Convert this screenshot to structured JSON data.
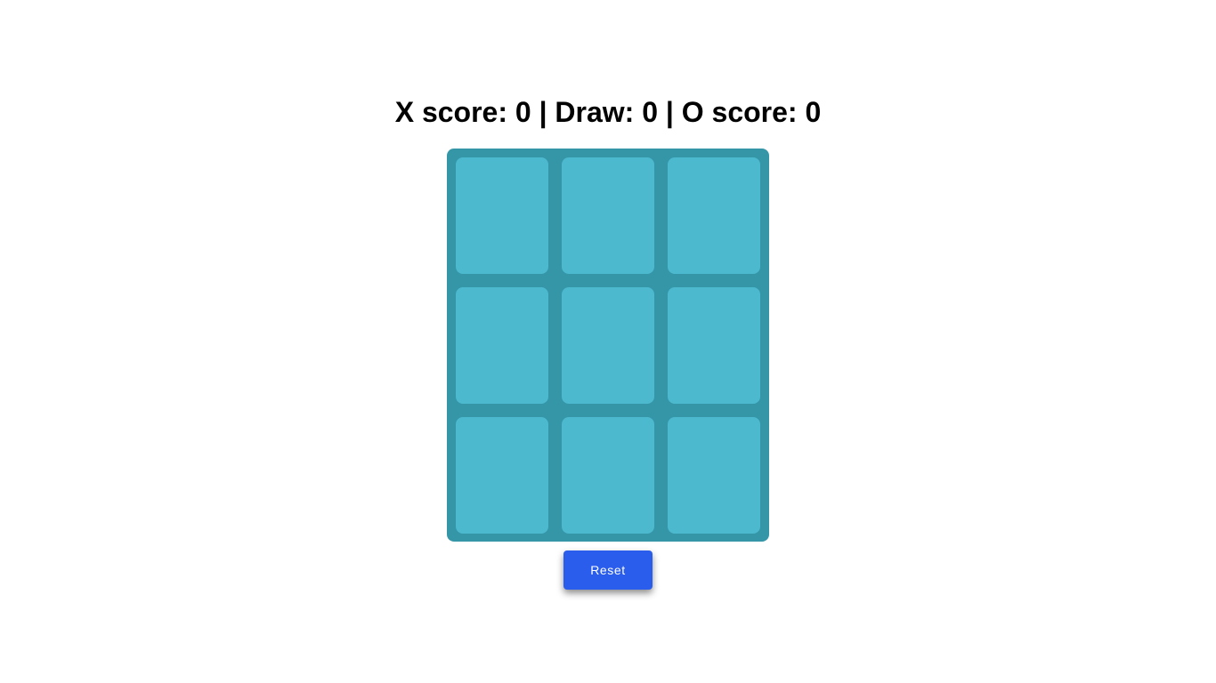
{
  "scoreboard": {
    "x_label": "X score: ",
    "x_score": "0",
    "sep1": " | ",
    "draw_label": "Draw: ",
    "draw_score": "0",
    "sep2": " | ",
    "o_label": "O score: ",
    "o_score": "0"
  },
  "board": {
    "cells": [
      "",
      "",
      "",
      "",
      "",
      "",
      "",
      "",
      ""
    ]
  },
  "controls": {
    "reset_label": "Reset"
  },
  "colors": {
    "board_background": "#3596a7",
    "cell_background": "#4cb9cf",
    "reset_button": "#2b5dec"
  }
}
